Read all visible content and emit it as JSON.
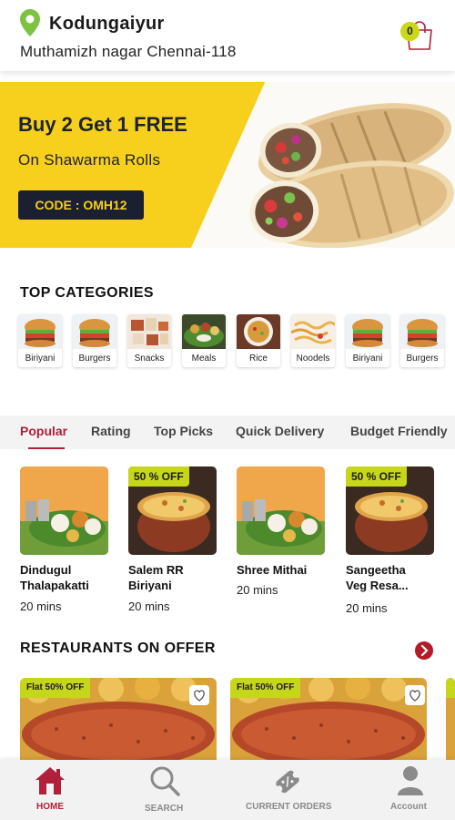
{
  "header": {
    "location_title": "Kodungaiyur",
    "location_subtitle": "Muthamizh nagar Chennai-118",
    "cart_count": "0",
    "icons": {
      "location": "map-pin-icon",
      "cart": "shopping-bag-icon"
    }
  },
  "banner": {
    "title": "Buy 2 Get 1 FREE",
    "subtitle": "On  Shawarma Rolls",
    "code": "CODE : OMH12"
  },
  "categories": {
    "title": "TOP CATEGORIES",
    "items": [
      {
        "label": "Biriyani"
      },
      {
        "label": "Burgers"
      },
      {
        "label": "Snacks"
      },
      {
        "label": "Meals"
      },
      {
        "label": "Rice"
      },
      {
        "label": "Noodels"
      },
      {
        "label": "Biriyani"
      },
      {
        "label": "Burgers"
      }
    ]
  },
  "tabs": [
    {
      "label": "Popular",
      "active": true
    },
    {
      "label": "Rating",
      "active": false
    },
    {
      "label": "Top Picks",
      "active": false
    },
    {
      "label": "Quick Delivery",
      "active": false
    },
    {
      "label": "Budget Friendly",
      "active": false
    }
  ],
  "dishes": [
    {
      "name": "Dindugul\nThalapakatti",
      "time": "20 mins",
      "offer": ""
    },
    {
      "name": "Salem RR\nBiriyani",
      "time": "20 mins",
      "offer": "50 % OFF"
    },
    {
      "name": "Shree Mithai",
      "time": "20 mins",
      "offer": ""
    },
    {
      "name": "Sangeetha\nVeg Resa...",
      "time": "20 mins",
      "offer": "50 % OFF"
    }
  ],
  "restaurants": {
    "title": "RESTAURANTS ON OFFER",
    "cards": [
      {
        "tag": "Flat 50% OFF"
      },
      {
        "tag": "Flat 50% OFF"
      }
    ]
  },
  "bottom_nav": [
    {
      "label": "HOME",
      "icon": "home-icon",
      "active": true
    },
    {
      "label": "SEARCH",
      "icon": "search-icon",
      "active": false
    },
    {
      "label": "CURRENT ORDERS",
      "icon": "coupon-tag-icon",
      "active": false
    },
    {
      "label": "Account",
      "icon": "user-icon",
      "active": false
    }
  ],
  "colors": {
    "accent": "#b0203a",
    "banner_yellow": "#f7cf1d",
    "offer_green": "#c6d61a",
    "nav_bg": "#f2f2f2"
  }
}
